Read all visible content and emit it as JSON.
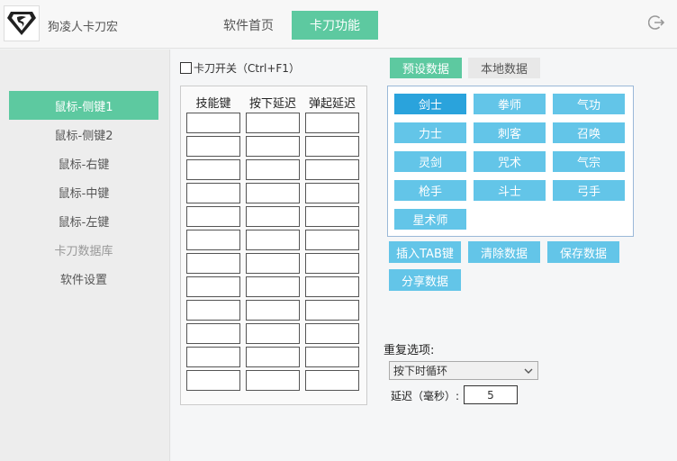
{
  "app": {
    "title": "狗凌人卡刀宏"
  },
  "top_tabs": [
    {
      "label": "软件首页",
      "active": false
    },
    {
      "label": "卡刀功能",
      "active": true
    }
  ],
  "sidebar": {
    "items": [
      {
        "label": "鼠标-侧键1",
        "active": true
      },
      {
        "label": "鼠标-侧键2",
        "active": false
      },
      {
        "label": "鼠标-右键",
        "active": false
      },
      {
        "label": "鼠标-中键",
        "active": false
      },
      {
        "label": "鼠标-左键",
        "active": false
      },
      {
        "label": "卡刀数据库",
        "active": false
      },
      {
        "label": "软件设置",
        "active": false
      }
    ]
  },
  "main": {
    "toggle_label": "卡刀开关（Ctrl+F1）",
    "table": {
      "headers": [
        "技能键",
        "按下延迟",
        "弹起延迟"
      ],
      "row_count": 12
    },
    "source_tabs": [
      {
        "label": "预设数据",
        "active": true
      },
      {
        "label": "本地数据",
        "active": false
      }
    ],
    "classes": [
      "剑士",
      "拳师",
      "气功",
      "力士",
      "刺客",
      "召唤",
      "灵剑",
      "咒术",
      "气宗",
      "枪手",
      "斗士",
      "弓手",
      "星术师"
    ],
    "selected_class": "剑士",
    "actions": {
      "insert_tab": "插入TAB键",
      "clear": "清除数据",
      "save": "保存数据",
      "share": "分享数据"
    },
    "repeat": {
      "label": "重复选项:",
      "selected": "按下时循环"
    },
    "delay": {
      "label": "延迟（毫秒）:",
      "value": "5"
    }
  },
  "colors": {
    "accent": "#5dc9a0",
    "class_button": "#63c5e8",
    "class_selected": "#2aa3dc"
  }
}
